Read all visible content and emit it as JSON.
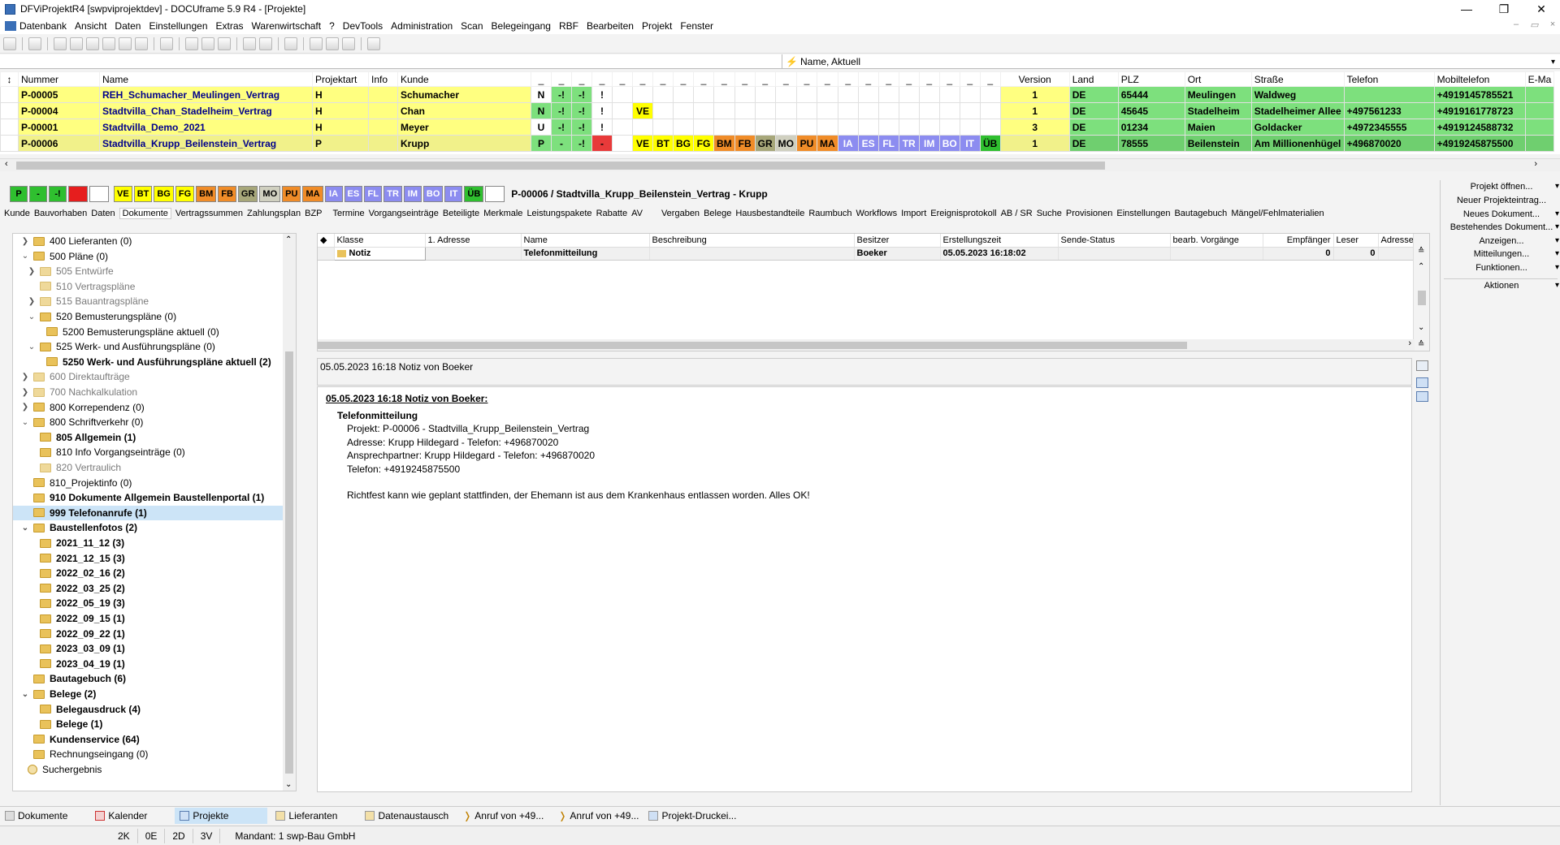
{
  "window": {
    "title": "DFViProjektR4 [swpviprojektdev] - DOCUframe 5.9 R4 - [Projekte]"
  },
  "menu": [
    "Datenbank",
    "Ansicht",
    "Daten",
    "Einstellungen",
    "Extras",
    "Warenwirtschaft",
    "?",
    "DevTools",
    "Administration",
    "Scan",
    "Belegeingang",
    "RBF",
    "Bearbeiten",
    "Projekt",
    "Fenster"
  ],
  "filter": {
    "label": "Name, Aktuell"
  },
  "grid": {
    "headers": {
      "nummer": "Nummer",
      "name": "Name",
      "projektart": "Projektart",
      "info": "Info",
      "kunde": "Kunde",
      "version": "Version",
      "land": "Land",
      "plz": "PLZ",
      "ort": "Ort",
      "strasse": "Straße",
      "telefon": "Telefon",
      "mobil": "Mobiltelefon",
      "email": "E-Ma"
    },
    "rows": [
      {
        "nummer": "P-00005",
        "name": "REH_Schumacher_Meulingen_Vertrag",
        "art": "H",
        "kunde": "Schumacher",
        "s1": "N",
        "s2": "-!",
        "s3": "-!",
        "s4": "!",
        "flag": "",
        "version": "1",
        "land": "DE",
        "plz": "65444",
        "ort": "Meulingen",
        "strasse": "Waldweg",
        "telefon": "",
        "mobil": "+4919145785521"
      },
      {
        "nummer": "P-00004",
        "name": "Stadtvilla_Chan_Stadelheim_Vertrag",
        "art": "H",
        "kunde": "Chan",
        "s1": "N",
        "s2": "-!",
        "s3": "-!",
        "s4": "!",
        "flag": "VE",
        "version": "1",
        "land": "DE",
        "plz": "45645",
        "ort": "Stadelheim",
        "strasse": "Stadelheimer Allee",
        "telefon": "+497561233",
        "mobil": "+4919161778723"
      },
      {
        "nummer": "P-00001",
        "name": "Stadtvilla_Demo_2021",
        "art": "H",
        "kunde": "Meyer",
        "s1": "U",
        "s2": "-!",
        "s3": "-!",
        "s4": "!",
        "flag": "",
        "version": "3",
        "land": "DE",
        "plz": "01234",
        "ort": "Maien",
        "strasse": "Goldacker",
        "telefon": "+4972345555",
        "mobil": "+4919124588732"
      },
      {
        "nummer": "P-00006",
        "name": "Stadtvilla_Krupp_Beilenstein_Vertrag",
        "art": "P",
        "kunde": "Krupp",
        "s1": "P",
        "s2": "-",
        "s3": "-!",
        "s4": "-",
        "flag": "",
        "version": "1",
        "land": "DE",
        "plz": "78555",
        "ort": "Beilenstein",
        "strasse": "Am Millionenhügel",
        "telefon": "+496870020",
        "mobil": "+4919245875500"
      }
    ],
    "phase_chips": [
      "VE",
      "BT",
      "BG",
      "FG",
      "BM",
      "FB",
      "GR",
      "MO",
      "PU",
      "MA",
      "IA",
      "ES",
      "FL",
      "TR",
      "IM",
      "BO",
      "IT",
      "ÜB"
    ]
  },
  "status": {
    "chips": [
      "P",
      "-",
      "-!",
      "",
      ""
    ],
    "phases": [
      "VE",
      "BT",
      "BG",
      "FG",
      "BM",
      "FB",
      "GR",
      "MO",
      "PU",
      "MA",
      "IA",
      "ES",
      "FL",
      "TR",
      "IM",
      "BO",
      "IT",
      "ÜB"
    ],
    "project": "P-00006 / Stadtvilla_Krupp_Beilenstein_Vertrag - Krupp"
  },
  "tabs": [
    "Kunde",
    "Bauvorhaben",
    "Daten",
    "Dokumente",
    "Vertragssummen",
    "Zahlungsplan",
    "BZP",
    "Termine",
    "Vorgangseinträge",
    "Beteiligte",
    "Merkmale",
    "Leistungspakete",
    "Rabatte",
    "AV",
    "Vergaben",
    "Belege",
    "Hausbestandteile",
    "Raumbuch",
    "Workflows",
    "Import",
    "Ereignisprotokoll",
    "AB / SR",
    "Suche",
    "Provisionen",
    "Einstellungen",
    "Bautagebuch",
    "Mängel/Fehlmaterialien"
  ],
  "tree": [
    {
      "label": "400 Lieferanten (0)"
    },
    {
      "label": "500 Pläne (0)"
    },
    {
      "label": "505 Entwürfe"
    },
    {
      "label": "510 Vertragspläne"
    },
    {
      "label": "515 Bauantragspläne"
    },
    {
      "label": "520 Bemusterungspläne (0)"
    },
    {
      "label": "5200 Bemusterungspläne aktuell (0)"
    },
    {
      "label": "525 Werk- und Ausführungspläne (0)"
    },
    {
      "label": "5250 Werk- und Ausführungspläne aktuell (2)"
    },
    {
      "label": "600 Direktaufträge"
    },
    {
      "label": "700 Nachkalkulation"
    },
    {
      "label": "800 Korrependenz (0)"
    },
    {
      "label": "800 Schriftverkehr (0)"
    },
    {
      "label": "805 Allgemein (1)"
    },
    {
      "label": "810 Info Vorgangseinträge (0)"
    },
    {
      "label": "820 Vertraulich"
    },
    {
      "label": "810_Projektinfo (0)"
    },
    {
      "label": "910 Dokumente Allgemein Baustellenportal (1)"
    },
    {
      "label": "999 Telefonanrufe (1)"
    },
    {
      "label": "Baustellenfotos (2)"
    },
    {
      "label": "2021_11_12 (3)"
    },
    {
      "label": "2021_12_15 (3)"
    },
    {
      "label": "2022_02_16 (2)"
    },
    {
      "label": "2022_03_25 (2)"
    },
    {
      "label": "2022_05_19 (3)"
    },
    {
      "label": "2022_09_15 (1)"
    },
    {
      "label": "2022_09_22 (1)"
    },
    {
      "label": "2023_03_09 (1)"
    },
    {
      "label": "2023_04_19 (1)"
    },
    {
      "label": "Bautagebuch (6)"
    },
    {
      "label": "Belege (2)"
    },
    {
      "label": "Belegausdruck (4)"
    },
    {
      "label": "Belege (1)"
    },
    {
      "label": "Kundenservice (64)"
    },
    {
      "label": "Rechnungseingang (0)"
    },
    {
      "label": "Suchergebnis"
    }
  ],
  "docs": {
    "headers": [
      "Klasse",
      "1. Adresse",
      "Name",
      "Beschreibung",
      "Besitzer",
      "Erstellungszeit",
      "Sende-Status",
      "bearb. Vorgänge",
      "Empfänger",
      "Leser",
      "Adresse"
    ],
    "row": {
      "klasse": "Notiz",
      "adresse": "",
      "name": "Telefonmitteilung",
      "beschreibung": "",
      "besitzer": "Boeker",
      "zeit": "05.05.2023 16:18:02",
      "status": "",
      "vorgaenge": "",
      "empfaenger": "0",
      "leser": "0"
    }
  },
  "preview": {
    "header": "05.05.2023 16:18 Notiz von Boeker",
    "title": "05.05.2023 16:18 Notiz von Boeker:",
    "subject": "Telefonmitteilung",
    "lines": [
      "Projekt: P-00006 - Stadtvilla_Krupp_Beilenstein_Vertrag",
      "Adresse: Krupp Hildegard - Telefon: +496870020",
      "Ansprechpartner: Krupp Hildegard - Telefon: +496870020",
      "Telefon: +4919245875500"
    ],
    "body": "Richtfest kann wie geplant stattfinden, der Ehemann ist aus dem Krankenhaus entlassen worden. Alles OK!"
  },
  "side": [
    "Projekt öffnen...",
    "Neuer Projekteintrag...",
    "Neues Dokument...",
    "Bestehendes Dokument...",
    "Anzeigen...",
    "Mitteilungen...",
    "Funktionen...",
    "Aktionen"
  ],
  "bottom": [
    "Dokumente",
    "Kalender",
    "Projekte",
    "Lieferanten",
    "Datenaustausch",
    "Anruf von +49...",
    "Anruf von +49...",
    "Projekt-Druckei..."
  ],
  "footer": [
    "2K",
    "0E",
    "2D",
    "3V",
    "Mandant: 1 swp-Bau GmbH"
  ],
  "colors": {
    "yellow": "#ffff80",
    "green": "#7de07d",
    "selected": "#cce4f7"
  }
}
